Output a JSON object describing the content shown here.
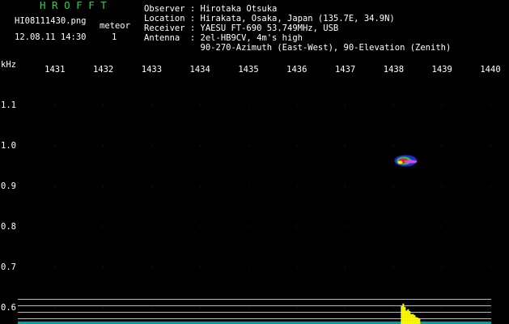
{
  "header": {
    "brand": "H R O F F T",
    "filename": "HI08111430.png",
    "detection_label": "meteor",
    "datetime": "12.08.11 14:30",
    "count": "1",
    "lines": [
      "Observer : Hirotaka Otsuka",
      "Location : Hirakata, Osaka, Japan (135.7E, 34.9N)",
      "Receiver : YAESU FT-690 53.749MHz, USB",
      "Antenna  : 2el-HB9CV, 4m's high",
      "           90-270-Azimuth (East-West), 90-Elevation (Zenith)"
    ]
  },
  "colors": {
    "background": "#000000",
    "brand": "#2fd14a",
    "text": "#ffffff",
    "grid_line": "#b9b9b9",
    "signal_high": "#ffff00",
    "noise_floor": "#00c8c8"
  },
  "chart_data": {
    "type": "heatmap",
    "ylabel": "kHz",
    "x_ticks": [
      "1431",
      "1432",
      "1433",
      "1434",
      "1435",
      "1436",
      "1437",
      "1438",
      "1439",
      "1440"
    ],
    "y_ticks": [
      "1.1",
      "1.0",
      "0.9",
      "0.8",
      "0.7",
      "0.6"
    ],
    "xlim": [
      1430.2,
      1440.3
    ],
    "ylim": [
      0.555,
      1.16
    ],
    "echo": {
      "x_center": 1438.25,
      "y_center": 0.963,
      "x_span": 0.4,
      "y_span": 0.05
    },
    "power_burst": {
      "x_start": 1438.15,
      "x_end": 1438.55,
      "peak": 1.0
    }
  }
}
